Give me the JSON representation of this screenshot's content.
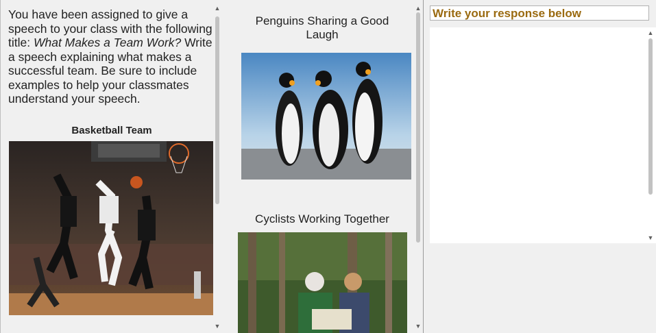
{
  "prompt": {
    "part1": "You have been assigned to give a speech to your class with the following title: ",
    "title_italic": "What Makes a Team Work?",
    "part2": " Write a speech explaining what makes a successful team. Be sure to include examples to help your classmates understand your speech."
  },
  "images": {
    "basketball_caption": "Basketball Team",
    "penguins_caption": "Penguins Sharing a Good Laugh",
    "cyclists_caption": "Cyclists Working Together"
  },
  "response": {
    "header": "Write your response below",
    "value": ""
  },
  "colors": {
    "header_text": "#9a6a10",
    "pane_bg": "#f0f0f0"
  }
}
